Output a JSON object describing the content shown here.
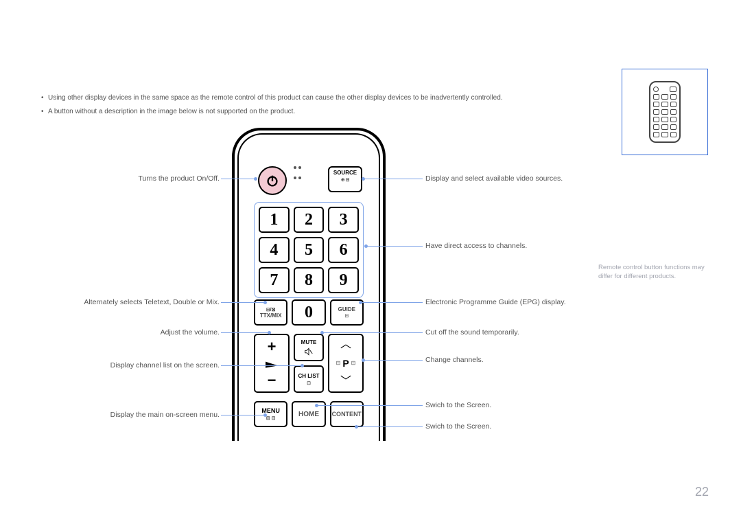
{
  "bullets": [
    "Using other display devices in the same space as the remote control of this product can cause the other display devices to be inadvertently controlled.",
    "A button without a description in the image below is not supported on the product."
  ],
  "disclaimer": "Remote control button functions may differ for different products.",
  "page_number": "22",
  "callouts": {
    "left": {
      "power": "Turns the product On/Off.",
      "ttx": "Alternately selects Teletext, Double or Mix.",
      "vol": "Adjust the volume.",
      "chlist": "Display channel list on the screen.",
      "menu": "Display the main on-screen menu."
    },
    "right": {
      "source": "Display and select available video sources.",
      "numpad": "Have direct access to channels.",
      "guide": "Electronic Programme Guide (EPG) display.",
      "mute": "Cut off the sound temporarily.",
      "prog": "Change channels.",
      "home": "Swich to the  Screen.",
      "content": "Swich to the  Screen."
    }
  },
  "remote": {
    "source": "SOURCE",
    "numbers": [
      "1",
      "2",
      "3",
      "4",
      "5",
      "6",
      "7",
      "8",
      "9"
    ],
    "ttx": "TTX/MIX",
    "zero": "0",
    "guide": "GUIDE",
    "mute": "MUTE",
    "chlist": "CH LIST",
    "prog": "P",
    "menu": "MENU",
    "home": "HOME",
    "content": "CONTENT"
  }
}
